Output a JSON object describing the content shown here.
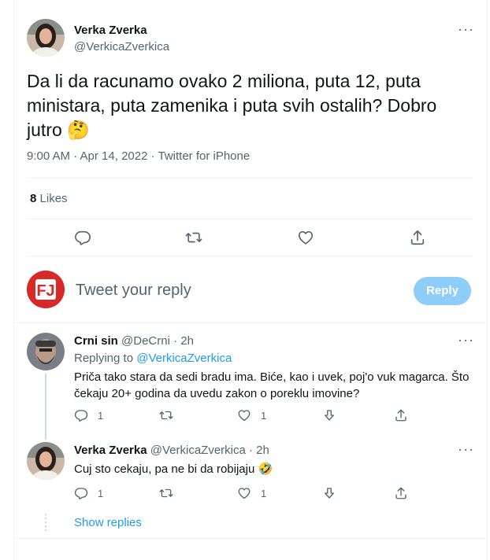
{
  "main_tweet": {
    "author_name": "Verka Zverka",
    "author_handle": "@VerkicaZverkica",
    "text_line1": "Da li da racunamo ovako 2 miliona, puta 12, puta",
    "text_line2": "ministara, puta zamenika i puta svih ostalih? Dobro",
    "text_line3": "jutro",
    "emoji": "🤔",
    "timestamp": "9:00 AM · Apr 14, 2022 · Twitter for iPhone",
    "likes_count": "8",
    "likes_label": "Likes",
    "more_label": "···"
  },
  "composer": {
    "placeholder": "Tweet your reply",
    "reply_button": "Reply",
    "avatar_letters": "FJ"
  },
  "replies": [
    {
      "author_name": "Crni sin",
      "author_handle": "@DeCrni",
      "time": "· 2h",
      "replying_prefix": "Replying to ",
      "replying_handle": "@VerkicaZverkica",
      "text_line1": "Priča tako stara da sedi bradu ima. Biće, kao i uvek, poj'o vuk magarca. Što",
      "text_line2": "čekaju 20+ godina da uvedu zakon o poreklu imovine?",
      "reply_count": "1",
      "like_count": "1",
      "more_label": "···"
    },
    {
      "author_name": "Verka Zverka",
      "author_handle": "@VerkicaZverkica",
      "time": "· 2h",
      "text_line1": "Cuj sto cekaju, pa ne bi da robijaju",
      "emoji": "🤣",
      "reply_count": "1",
      "like_count": "1",
      "more_label": "···"
    }
  ],
  "show_replies_label": "Show replies",
  "icons": {
    "reply": "reply-icon",
    "retweet": "retweet-icon",
    "like": "heart-icon",
    "share": "share-icon",
    "vote": "vote-down-icon"
  },
  "colors": {
    "accent": "#1d9bf0",
    "reply_button_bg": "#8ecdf8",
    "muted_text": "#536471",
    "divider": "#eff3f4"
  }
}
